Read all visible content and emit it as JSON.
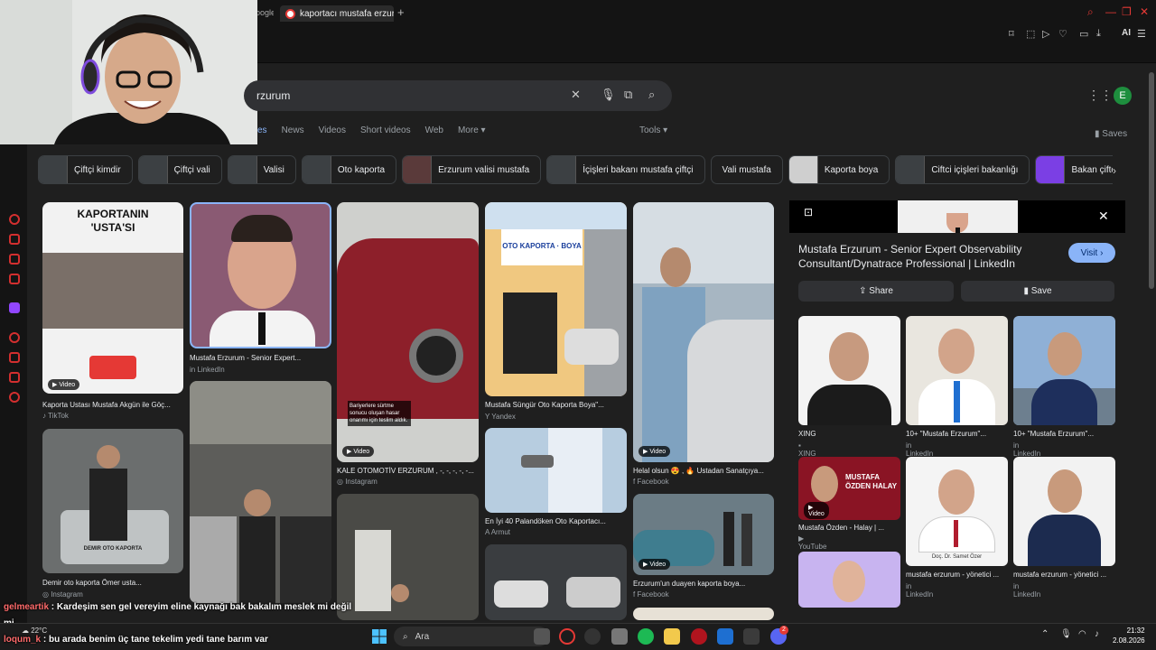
{
  "browser": {
    "active_tab_title": "kaportacı mustafa erzurum",
    "inactive_tab_fragment": "oogle",
    "ai_label": "AI"
  },
  "search": {
    "query_visible": "rzurum",
    "nav_tabs": [
      "es",
      "News",
      "Videos",
      "Short videos",
      "Web",
      "More ▾"
    ],
    "tools_label": "Tools ▾",
    "saves_label": "Saves",
    "account_initial": "E"
  },
  "chips": [
    "Çiftçi kimdir",
    "Çiftçi vali",
    "Valisi",
    "Oto kaporta",
    "Erzurum valisi mustafa",
    "İçişleri bakanı mustafa çiftçi",
    "Vali mustafa",
    "Kaporta boya",
    "Ciftci içişleri bakanlığı",
    "Bakan çiftçi"
  ],
  "results": {
    "col1": [
      {
        "title": "Kaporta Ustası Mustafa Akgün ile Göç...",
        "source": "TikTok",
        "badge": "Video",
        "overlay_lines": [
          "KAPORTANIN",
          "'USTA'SI"
        ]
      },
      {
        "title": "Demir oto kaporta Ömer usta...",
        "source": "Instagram",
        "overlay": "DEMIR OTO KAPORTA"
      }
    ],
    "col2": [
      {
        "title": "Mustafa Erzurum - Senior Expert...",
        "source": "LinkedIn"
      },
      {
        "title": "",
        "source": ""
      }
    ],
    "col3": [
      {
        "title": "KALE OTOMOTİV ERZURUM , -, -, -, -, -...",
        "source": "Instagram",
        "badge": "Video",
        "overlay": "Bariyerlere sürtme sonucu oluşan hasar onarımı için teslim aldık."
      },
      {
        "title": "",
        "source": ""
      }
    ],
    "col4": [
      {
        "title": "Mustafa Süngür Oto Kaporta Boya\"...",
        "source": "Yandex",
        "overlay": "OTO KAPORTA · BOYA"
      },
      {
        "title": "En İyi 40 Palandöken Oto Kaportacı...",
        "source": "Armut"
      },
      {
        "title": "",
        "source": ""
      }
    ],
    "col5": [
      {
        "title": "Helal olsun 😍 , 🔥 Ustadan Sanatçıya...",
        "source": "Facebook",
        "badge": "Video"
      },
      {
        "title": "Erzurum'un duayen kaporta boya...",
        "source": "Facebook",
        "badge": "Video"
      }
    ],
    "video_label": "Video"
  },
  "panel": {
    "title": "Mustafa Erzurum - Senior Expert Observability Consultant/Dynatrace Professional | LinkedIn",
    "visit_label": "Visit",
    "share_label": "Share",
    "save_label": "Save",
    "related": [
      {
        "title": "XING",
        "source": "XING"
      },
      {
        "title": "10+ \"Mustafa Erzurum\"...",
        "source": "LinkedIn"
      },
      {
        "title": "10+ \"Mustafa Erzurum\"...",
        "source": "LinkedIn"
      },
      {
        "title": "Mustafa Özden - Halay | ...",
        "source": "YouTube",
        "badge": "Video",
        "overlay": "MUSTAFA ÖZDEN HALAY"
      },
      {
        "title": "mustafa erzurum - yönetici ...",
        "source": "LinkedIn",
        "overlay": "Doç. Dr. Samet Özer"
      },
      {
        "title": "mustafa erzurum - yönetici ...",
        "source": "LinkedIn"
      }
    ]
  },
  "chat": [
    {
      "user": "gelmeartik",
      "message": " : Kardeşim sen gel vereyim eline kaynağı bak bakalım meslek mi değil"
    },
    {
      "user": "",
      "message": "mi"
    },
    {
      "user": "loqum_k",
      "message": " : bu arada benim üç tane tekelim yedi tane barım var"
    }
  ],
  "taskbar": {
    "search_label": "Ara",
    "weather": "22°C",
    "time": "21:32",
    "date": "2.08.2026",
    "badge": "2"
  },
  "colors": {
    "accent": "#8ab4f8",
    "brand_red": "#e53935",
    "bg": "#1f1f1f"
  }
}
